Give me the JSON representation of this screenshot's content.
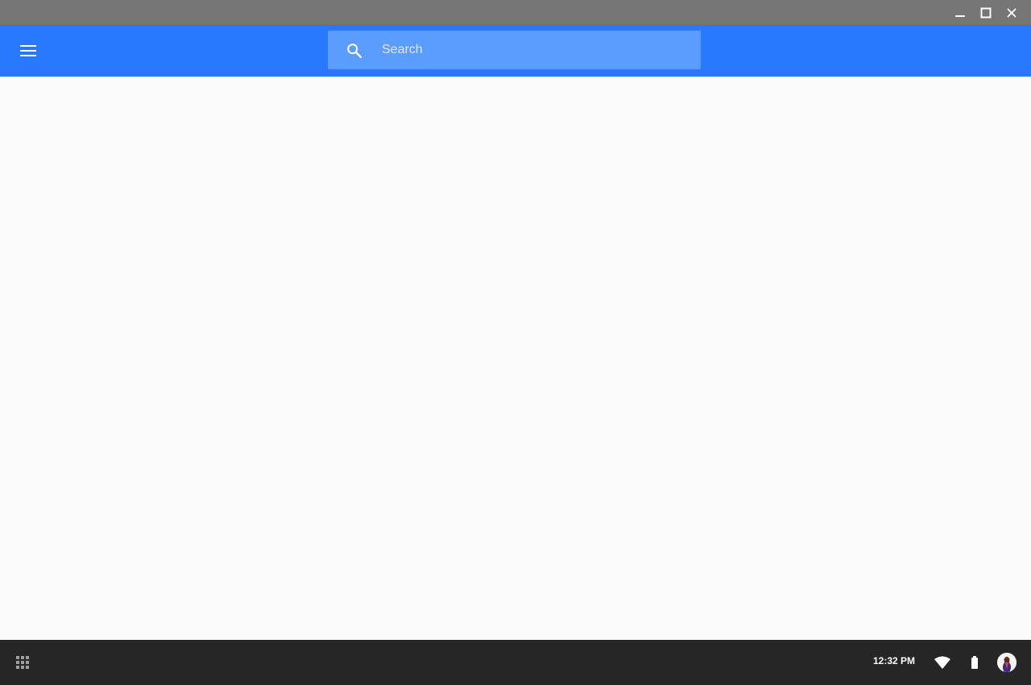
{
  "window": {
    "controls": {
      "minimize_icon": "minimize-icon",
      "maximize_icon": "maximize-icon",
      "close_icon": "close-icon"
    }
  },
  "appbar": {
    "background": "#2979ff",
    "menu_icon": "hamburger-menu-icon",
    "search": {
      "placeholder": "Search",
      "value": "",
      "icon": "search-icon"
    }
  },
  "shelf": {
    "launcher_icon": "app-launcher-icon",
    "time": "12:32 PM",
    "wifi_icon": "wifi-icon",
    "battery_icon": "battery-icon",
    "avatar_icon": "user-avatar"
  }
}
